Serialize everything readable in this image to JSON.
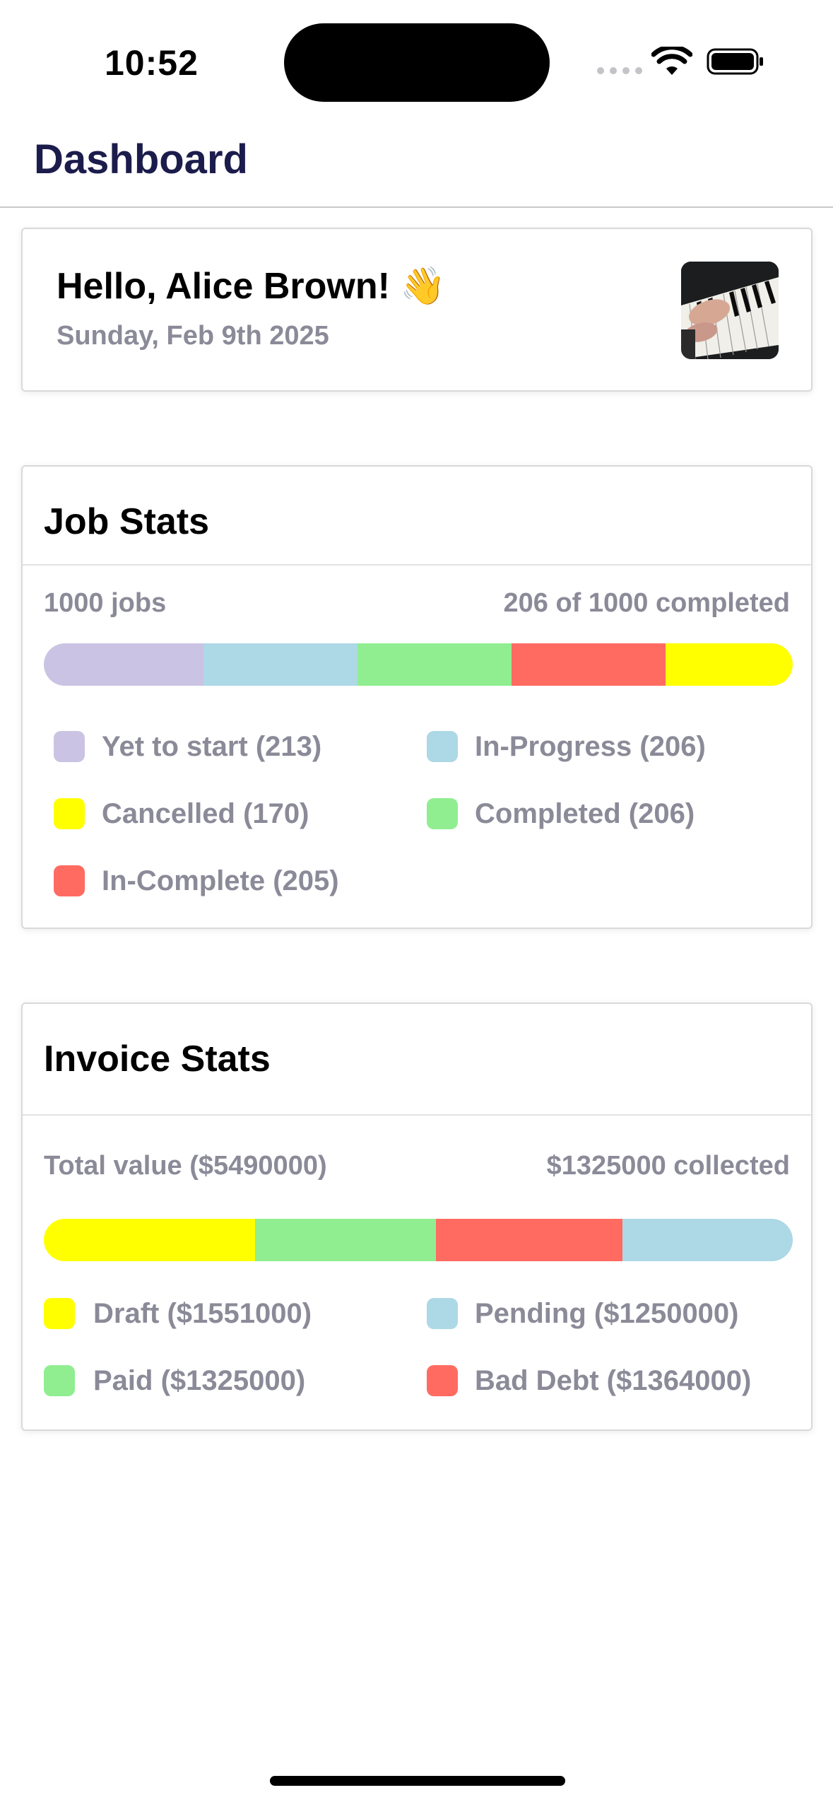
{
  "status_bar": {
    "time": "10:52"
  },
  "header": {
    "title": "Dashboard"
  },
  "greeting_card": {
    "greeting": "Hello, Alice Brown! 👋",
    "date": "Sunday, Feb 9th 2025"
  },
  "job_stats": {
    "title": "Job Stats",
    "total_label": "1000 jobs",
    "completed_label": "206 of 1000 completed",
    "bar": [
      {
        "name": "Yet to start",
        "value": 213,
        "color": "#cbc3e3"
      },
      {
        "name": "In-Progress",
        "value": 206,
        "color": "#add8e6"
      },
      {
        "name": "Completed",
        "value": 206,
        "color": "#90ee90"
      },
      {
        "name": "In-Complete",
        "value": 205,
        "color": "#ff6b61"
      },
      {
        "name": "Cancelled",
        "value": 170,
        "color": "#ffff00"
      }
    ],
    "legend": [
      {
        "label": "Yet to start (213)",
        "color": "#cbc3e3"
      },
      {
        "label": "In-Progress (206)",
        "color": "#add8e6"
      },
      {
        "label": "Cancelled (170)",
        "color": "#ffff00"
      },
      {
        "label": "Completed (206)",
        "color": "#90ee90"
      },
      {
        "label": "In-Complete (205)",
        "color": "#ff6b61"
      }
    ]
  },
  "invoice_stats": {
    "title": "Invoice Stats",
    "total_label": "Total value ($5490000)",
    "collected_label": "$1325000 collected",
    "bar": [
      {
        "name": "Draft",
        "value": 1551000,
        "color": "#ffff00"
      },
      {
        "name": "Paid",
        "value": 1325000,
        "color": "#90ee90"
      },
      {
        "name": "Bad Debt",
        "value": 1364000,
        "color": "#ff6b61"
      },
      {
        "name": "Pending",
        "value": 1250000,
        "color": "#add8e6"
      }
    ],
    "legend": [
      {
        "label": "Draft ($1551000)",
        "color": "#ffff00"
      },
      {
        "label": "Pending ($1250000)",
        "color": "#add8e6"
      },
      {
        "label": "Paid ($1325000)",
        "color": "#90ee90"
      },
      {
        "label": "Bad Debt ($1364000)",
        "color": "#ff6b61"
      }
    ]
  }
}
